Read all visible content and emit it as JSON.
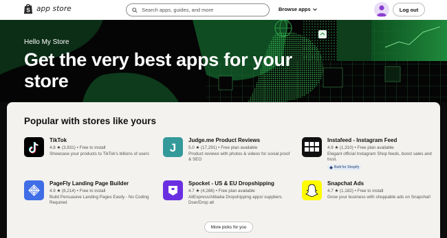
{
  "nav": {
    "logo_text": "app store",
    "search_placeholder": "Search apps, guides, and more",
    "browse_label": "Browse apps",
    "logout_label": "Log out"
  },
  "hero": {
    "greeting": "Hello My Store",
    "title": "Get the very best apps for your store"
  },
  "section": {
    "title": "Popular with stores like yours",
    "more_label": "More picks for you"
  },
  "apps": [
    {
      "name": "TikTok",
      "rating": "4.8",
      "reviews": "(3,931)",
      "pricing": "Free to install",
      "description": "Showcase your products to TikTok's billions of users",
      "icon": "tiktok-icon"
    },
    {
      "name": "Judge.me Product Reviews",
      "rating": "5.0",
      "reviews": "(17,291)",
      "pricing": "Free plan available",
      "description": "Product reviews with photos & videos for social proof & SEO",
      "icon": "judgeme-icon"
    },
    {
      "name": "Instafeed ‑ Instagram Feed",
      "rating": "4.9",
      "reviews": "(1,310)",
      "pricing": "Free plan available",
      "description": "Elegant official Instagram Shop feeds, boost sales and trust.",
      "badge": "Built for Shopify",
      "icon": "instafeed-icon"
    },
    {
      "name": "PageFly Landing Page Builder",
      "rating": "4.9",
      "reviews": "(8,214)",
      "pricing": "Free to install",
      "description": "Build Persuasive Landing Pages Easily - No Coding Required",
      "icon": "pagefly-icon"
    },
    {
      "name": "Spocket ‑ US & EU Dropshipping",
      "rating": "4.7",
      "reviews": "(4,286)",
      "pricing": "Free plan available",
      "description": "AliExpress/Alibaba Dropshipping apps/ suppliers. Dser/Drop alt",
      "icon": "spocket-icon"
    },
    {
      "name": "Snapchat Ads",
      "rating": "4.7",
      "reviews": "(1,182)",
      "pricing": "Free to install",
      "description": "Grow your business with shoppable ads on Snapchat!",
      "icon": "snapchat-icon"
    }
  ],
  "separator": "•",
  "star": "★",
  "colors": {
    "hero_green": "#1f8a3b",
    "judgeme": "#339999",
    "pagefly": "#3f6ee6",
    "spocket": "#6b2fe2",
    "snapchat": "#fffc00",
    "card_bg": "#f3f2ef"
  }
}
